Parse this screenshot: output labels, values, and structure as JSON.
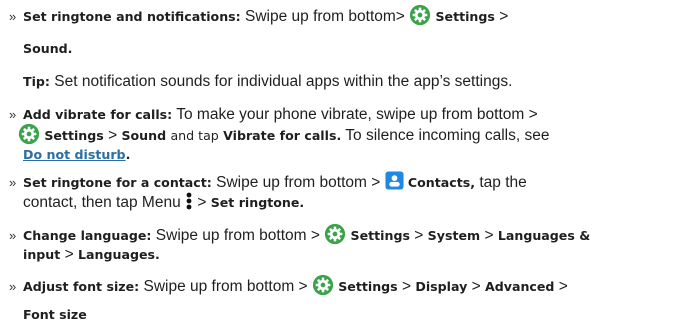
{
  "items": [
    {
      "bullet": "»",
      "label": "Set ringtone and notifications:",
      "text1": "Swipe up from bottom>",
      "settings": "Settings",
      "gt1": ">",
      "sound": "Sound."
    },
    {
      "tip_label": "Tip:",
      "tip_text": "Set notification sounds for individual apps within the app’s settings."
    },
    {
      "bullet": "»",
      "label": "Add vibrate for calls:",
      "text1": "To make your phone vibrate, swipe  up from bottom >",
      "settings": "Settings",
      "gt1": ">",
      "sound": "Sound",
      "and_tap": "and tap",
      "vibrate": "Vibrate for calls.",
      "silence": "To silence incoming calls, see",
      "dnd": "Do not disturb",
      "period": "."
    },
    {
      "bullet": "»",
      "label": "Set ringtone for a contact:",
      "text1": "Swipe up from bottom >",
      "contacts": "Contacts,",
      "text2": "tap the",
      "text3": "contact, then tap Menu",
      "gt1": ">",
      "set_ringtone": "Set ringtone."
    },
    {
      "bullet": "»",
      "label": "Change language:",
      "text1": "Swipe  up from bottom >",
      "settings": "Settings",
      "gt1": ">",
      "system": "System",
      "gt2": ">",
      "languages_input": "Languages &",
      "input": "input",
      "gt3": ">",
      "languages": "Languages."
    },
    {
      "bullet": "»",
      "label": "Adjust font size:",
      "text1": "Swipe up from bottom >",
      "settings": "Settings",
      "gt1": ">",
      "display": "Display",
      "gt2": ">",
      "advanced": "Advanced",
      "gt3": ">",
      "font_size": "Font size"
    }
  ],
  "icons": {
    "settings_icon_color": "#3aa34a",
    "contacts_icon_color": "#1e88e5"
  }
}
